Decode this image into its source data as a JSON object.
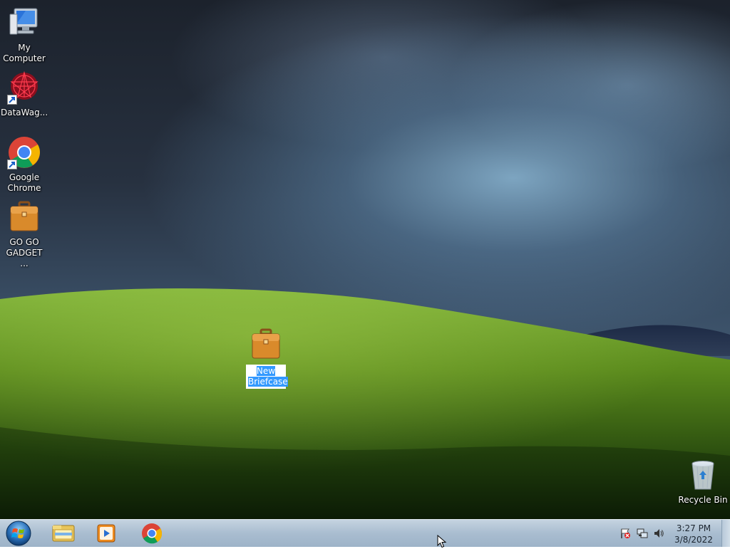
{
  "desktop": {
    "icons": [
      {
        "name": "my-computer",
        "label": "My Computer"
      },
      {
        "name": "datawag",
        "label": "DataWag..."
      },
      {
        "name": "google-chrome",
        "label": "Google Chrome"
      },
      {
        "name": "go-go-gadget",
        "label": "GO GO GADGET ..."
      },
      {
        "name": "new-briefcase",
        "label": "New Briefcase"
      },
      {
        "name": "recycle-bin",
        "label": "Recycle Bin"
      }
    ]
  },
  "taskbar": {
    "start_icon": "windows-orb-icon",
    "pinned": [
      {
        "name": "windows-explorer",
        "icon": "folder-icon"
      },
      {
        "name": "media-player",
        "icon": "media-player-icon"
      },
      {
        "name": "google-chrome",
        "icon": "chrome-icon"
      }
    ],
    "tray": {
      "icons": [
        "action-center-flag-icon",
        "network-icon",
        "volume-icon"
      ],
      "time": "3:27 PM",
      "date": "3/8/2022"
    }
  },
  "colors": {
    "selection": "#3399ff",
    "taskbar": "#a9bdd0",
    "grass": "#5a8a1c",
    "sky": "#4f6e8c"
  }
}
